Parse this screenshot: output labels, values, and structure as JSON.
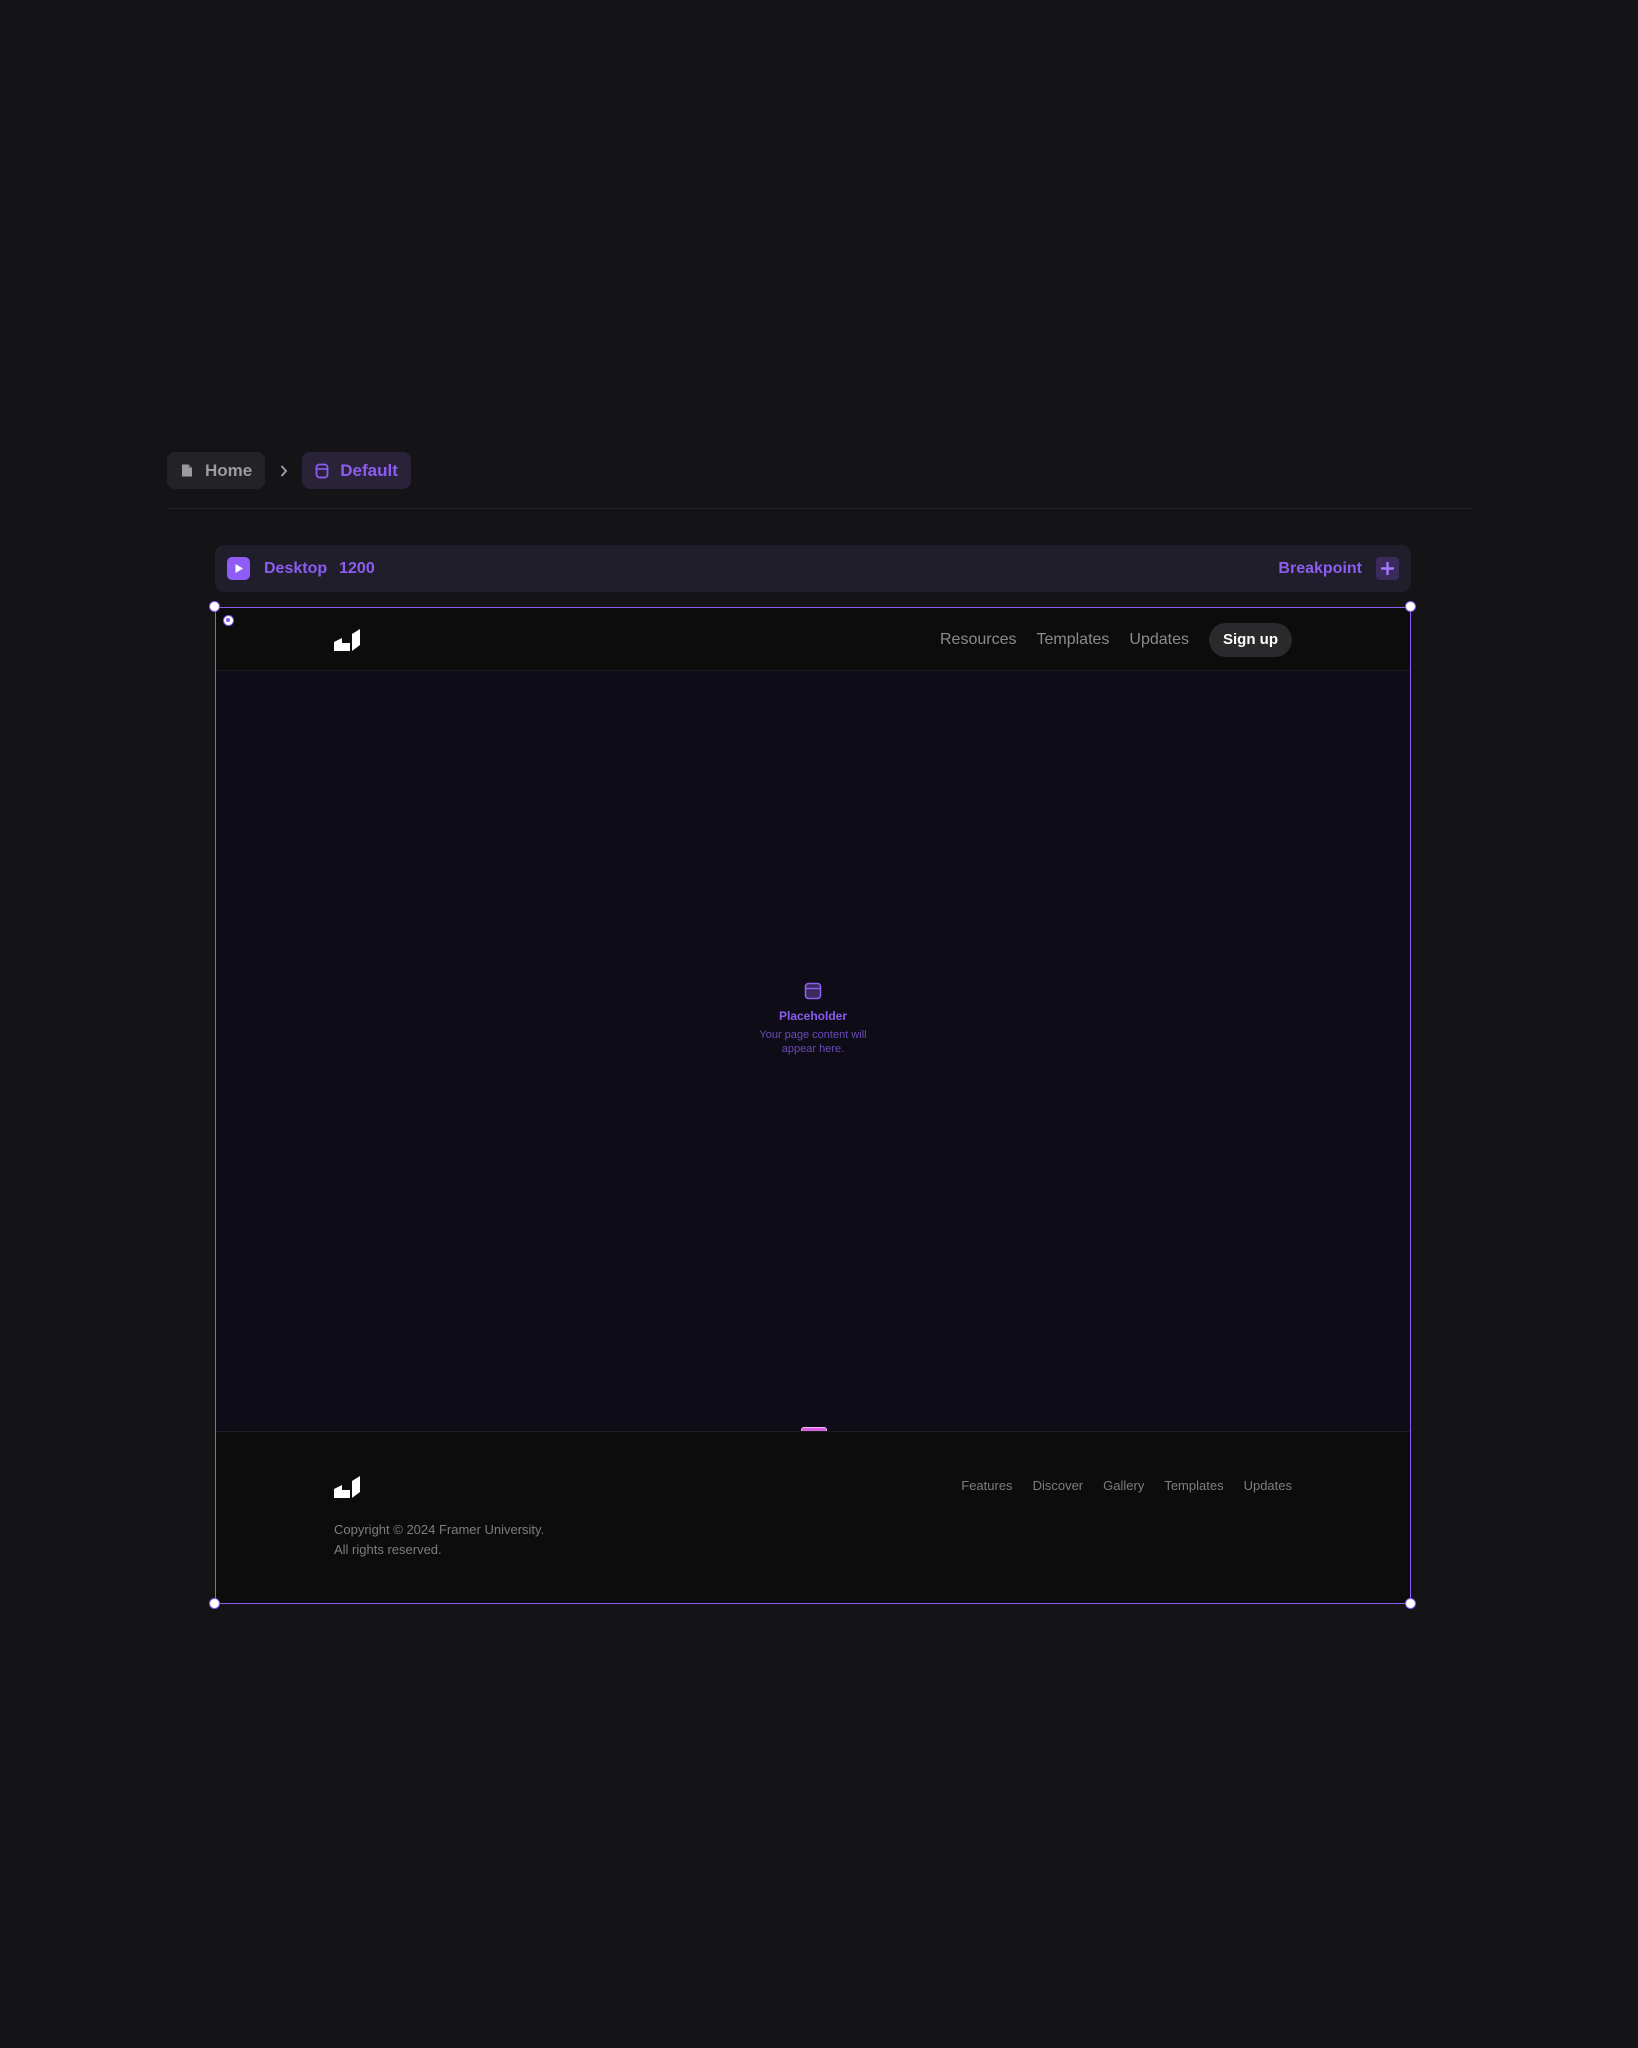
{
  "breadcrumb": {
    "home_label": "Home",
    "current_label": "Default"
  },
  "breakpoint_bar": {
    "name": "Desktop",
    "width": "1200",
    "add_label": "Breakpoint"
  },
  "site": {
    "nav": {
      "links": [
        "Resources",
        "Templates",
        "Updates"
      ],
      "cta": "Sign up"
    },
    "placeholder": {
      "title": "Placeholder",
      "text": "Your page content will appear here."
    },
    "footer": {
      "copyright": "Copyright © 2024 Framer University.",
      "rights": "All rights reserved.",
      "links": [
        "Features",
        "Discover",
        "Gallery",
        "Templates",
        "Updates"
      ]
    }
  },
  "colors": {
    "accent": "#8d5cf0",
    "canvas_bg": "#141416",
    "frame_border": "#8a5cf0"
  },
  "icons": {
    "home": "page-icon",
    "default": "template-icon",
    "play": "play-icon",
    "add": "plus-icon",
    "logo": "framer-u-logo",
    "placeholder": "placeholder-icon"
  }
}
